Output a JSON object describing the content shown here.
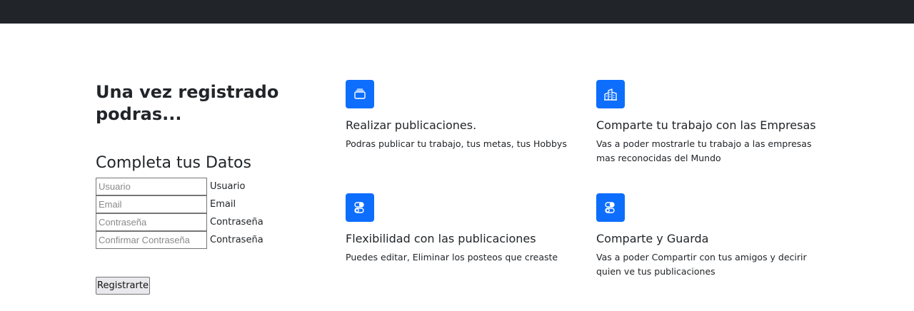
{
  "hero": {
    "title": "Una vez registrado podras..."
  },
  "form": {
    "title": "Completa tus Datos",
    "fields": [
      {
        "placeholder": "Usuario",
        "label": "Usuario"
      },
      {
        "placeholder": "Email",
        "label": "Email"
      },
      {
        "placeholder": "Contraseña",
        "label": "Contraseña"
      },
      {
        "placeholder": "Confirmar Contraseña",
        "label": "Contraseña"
      }
    ],
    "submit_label": "Registrarte"
  },
  "features": [
    {
      "icon": "collection-icon",
      "title": "Realizar publicaciones.",
      "description": "Podras publicar tu trabajo, tus metas, tus Hobbys"
    },
    {
      "icon": "building-icon",
      "title": "Comparte tu trabajo con las Empresas",
      "description": "Vas a poder mostrarle tu trabajo a las empresas mas reconocidas del Mundo"
    },
    {
      "icon": "toggles-icon",
      "title": "Flexibilidad con las publicaciones",
      "description": "Puedes editar, Eliminar los posteos que creaste"
    },
    {
      "icon": "toggles-icon",
      "title": "Comparte y Guarda",
      "description": "Vas a poder Compartir con tus amigos y decirir quien ve tus publicaciones"
    }
  ],
  "colors": {
    "navbar": "#212529",
    "accent": "#0d6efd"
  }
}
